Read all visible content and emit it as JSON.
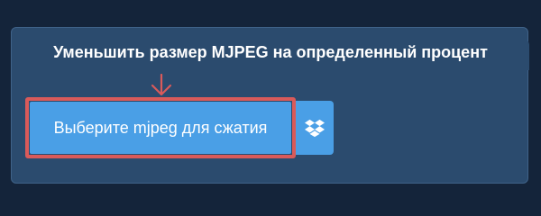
{
  "page": {
    "title": "Уменьшить размер MJPEG на определенный процент"
  },
  "upload": {
    "button_label": "Выберите mjpeg для сжатия",
    "dropbox_icon": "dropbox-icon",
    "pointer_icon": "down-arrow-icon"
  },
  "colors": {
    "background": "#14243a",
    "panel": "#2b4b6e",
    "button": "#4a9fe6",
    "highlight": "#d95a5a",
    "text": "#ffffff"
  }
}
